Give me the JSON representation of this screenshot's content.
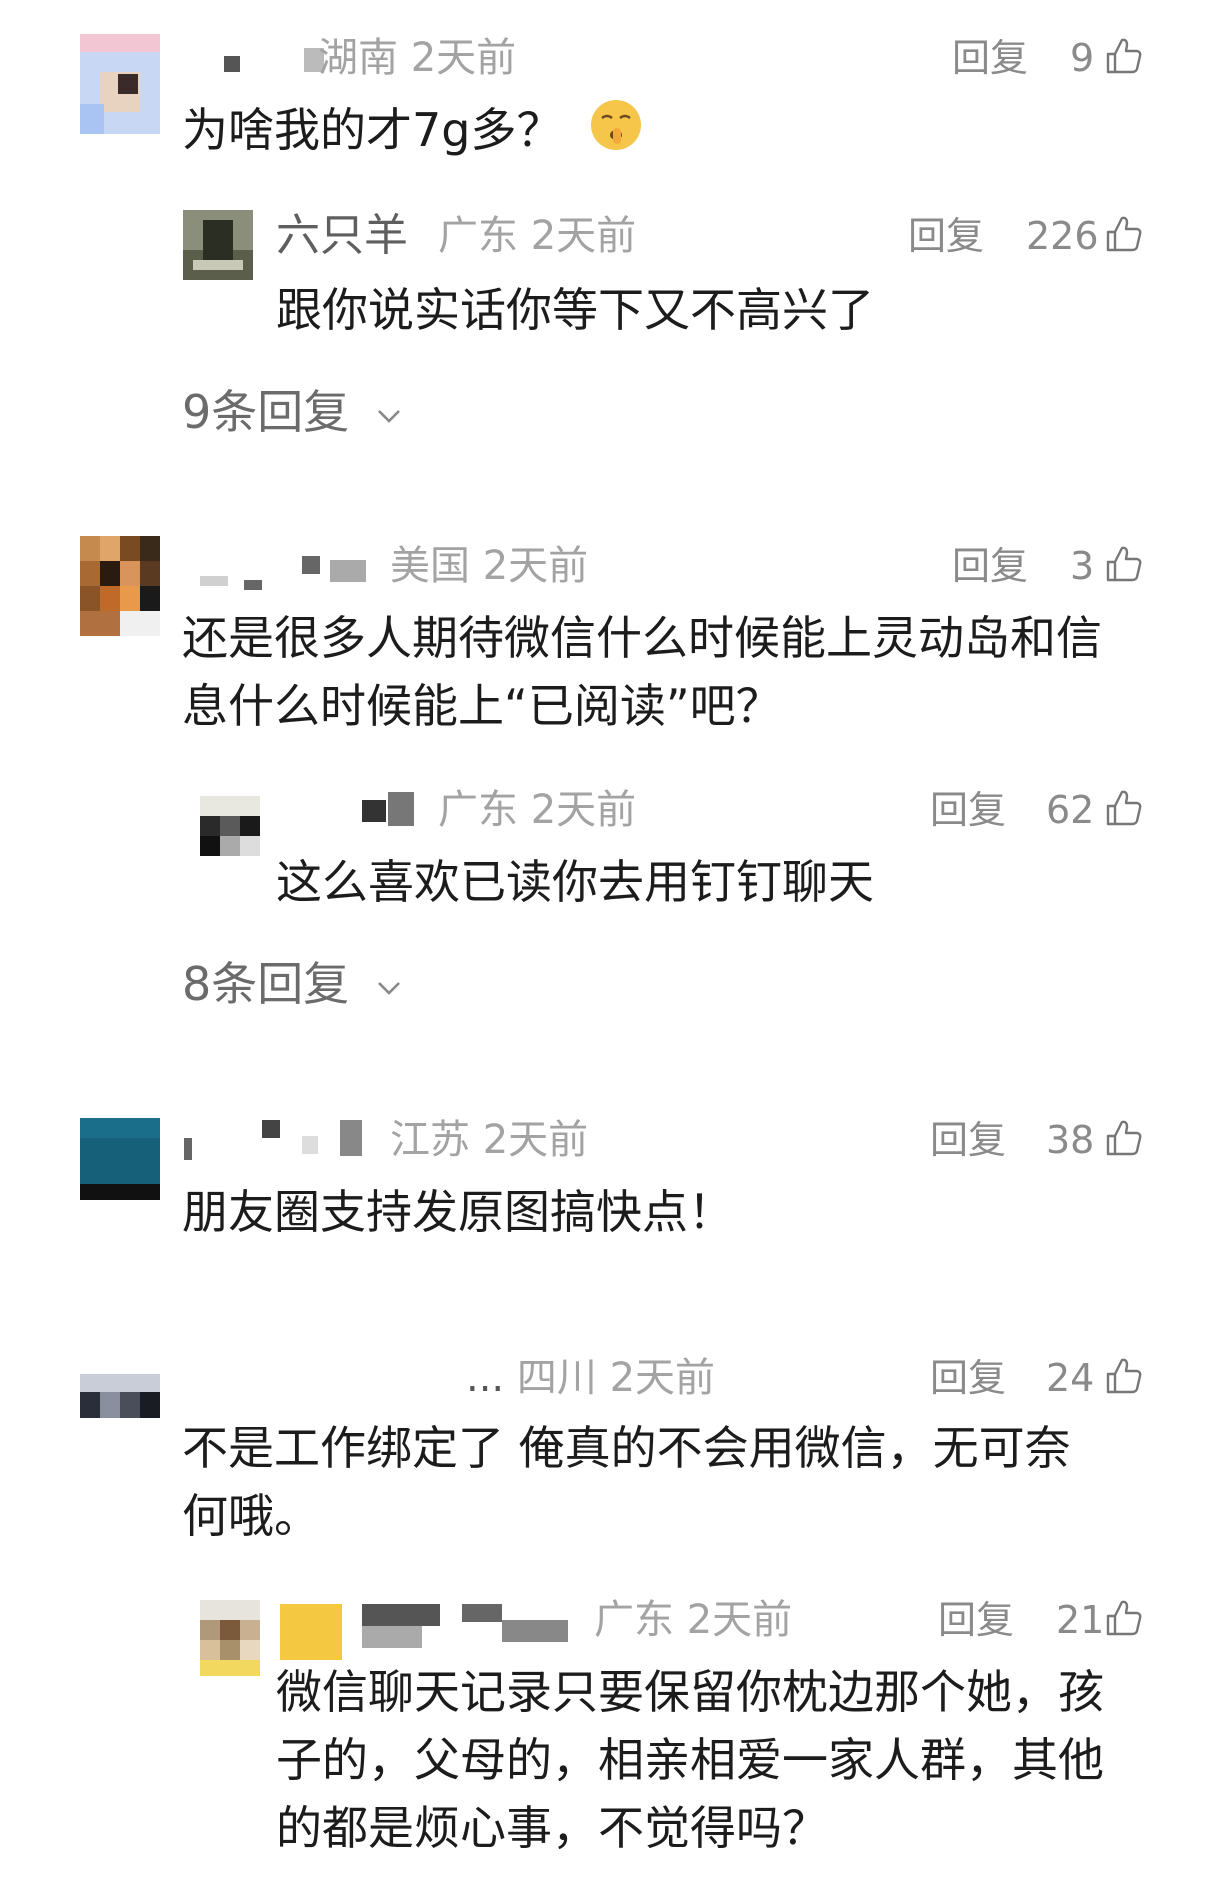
{
  "comments": [
    {
      "name_partial": "湖南",
      "location_time": "2天前",
      "reply": "回复",
      "likes": "9",
      "text": "为啥我的才7g多？",
      "emoji_icon": "shushing-face-icon"
    },
    {
      "name": "六只羊",
      "location_time": "广东 2天前",
      "reply": "回复",
      "likes": "226",
      "text": "跟你说实话你等下又不高兴了"
    },
    {
      "more": "9条回复"
    },
    {
      "location_time": "美国 2天前",
      "reply": "回复",
      "likes": "3",
      "text_line1": "还是很多人期待微信什么时候能上灵动岛和信",
      "text_line2": "息什么时候能上“已阅读”吧？"
    },
    {
      "location_time": "广东 2天前",
      "reply": "回复",
      "likes": "62",
      "text": "这么喜欢已读你去用钉钉聊天"
    },
    {
      "more": "8条回复"
    },
    {
      "location_time": "江苏 2天前",
      "reply": "回复",
      "likes": "38",
      "text": "朋友圈支持发原图搞快点！"
    },
    {
      "name_partial": "...",
      "location_time": "四川 2天前",
      "reply": "回复",
      "likes": "24",
      "text_line1": "不是工作绑定了 俺真的不会用微信，无可奈",
      "text_line2": "何哦。"
    },
    {
      "location_time": "广东 2天前",
      "reply": "回复",
      "likes": "21",
      "text_line1": "微信聊天记录只要保留你枕边那个她，孩",
      "text_line2": "子的，父母的，相亲相爱一家人群，其他",
      "text_line3": "的都是烦心事，不觉得吗？"
    }
  ]
}
